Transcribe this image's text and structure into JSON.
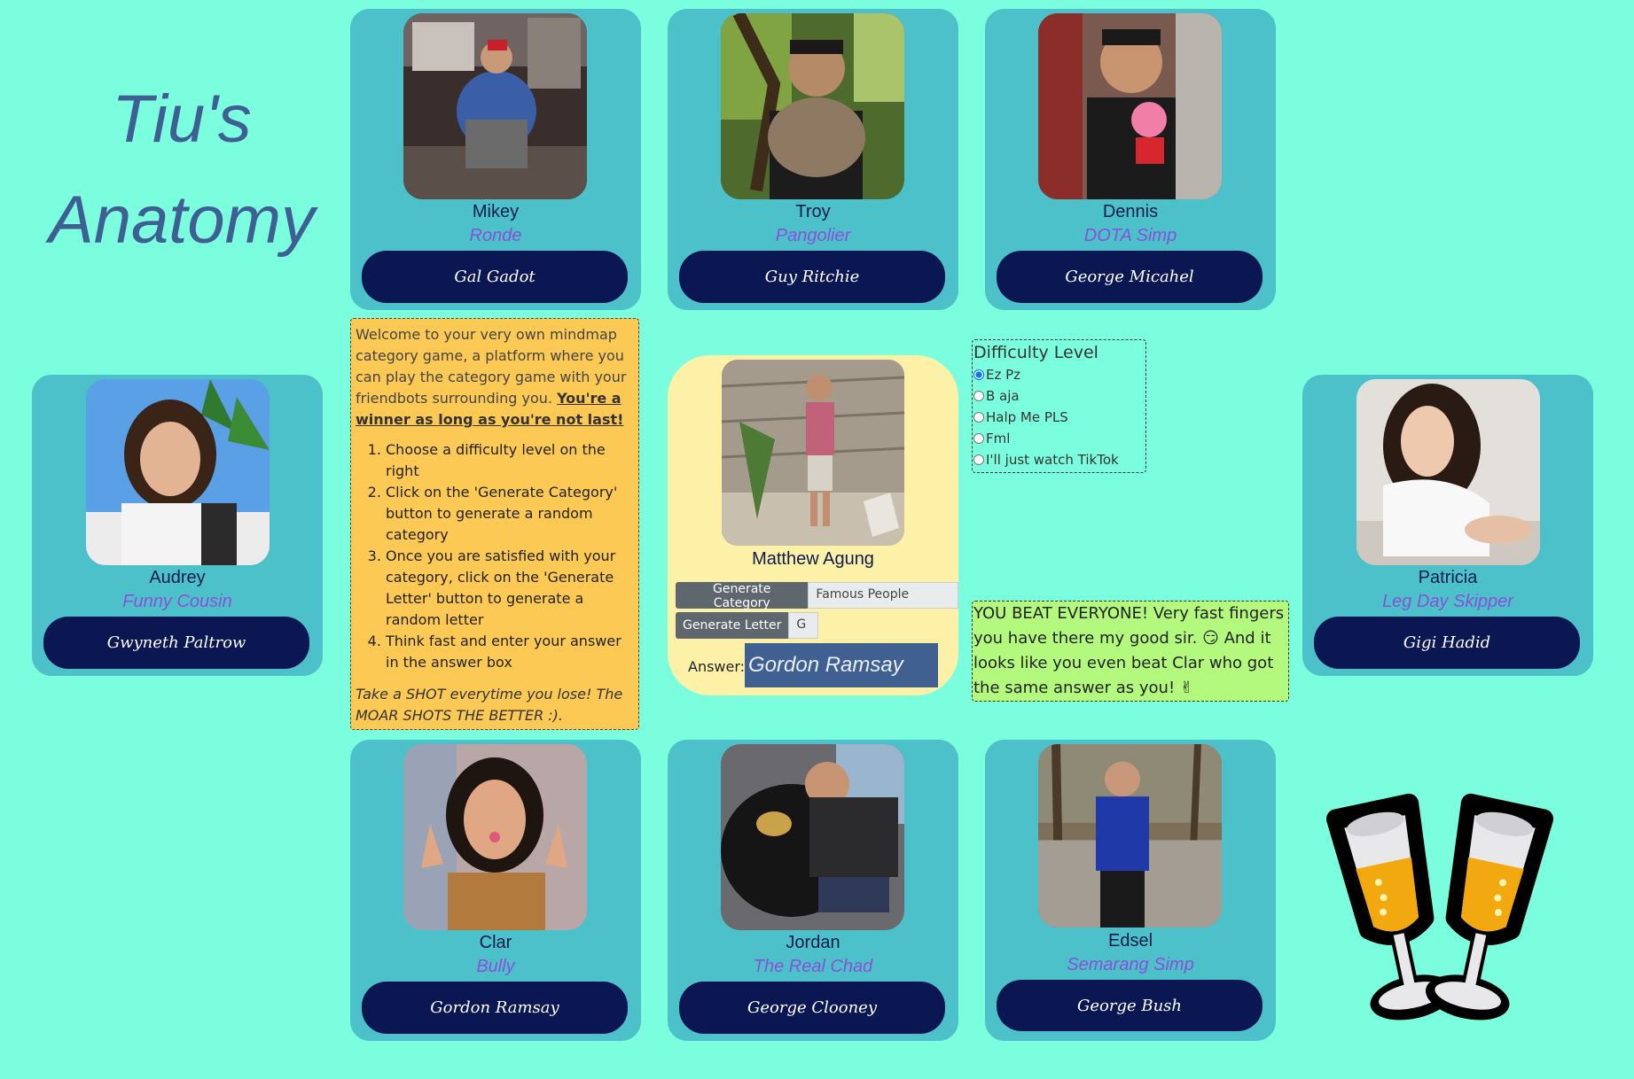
{
  "title": {
    "line1": "Tiu's",
    "line2": "Anatomy"
  },
  "players": [
    {
      "id": "mikey",
      "name": "Mikey",
      "role": "Ronde",
      "answer": "Gal Gadot"
    },
    {
      "id": "troy",
      "name": "Troy",
      "role": "Pangolier",
      "answer": "Guy Ritchie"
    },
    {
      "id": "dennis",
      "name": "Dennis",
      "role": "DOTA Simp",
      "answer": "George Micahel"
    },
    {
      "id": "audrey",
      "name": "Audrey",
      "role": "Funny Cousin",
      "answer": "Gwyneth Paltrow"
    },
    {
      "id": "patricia",
      "name": "Patricia",
      "role": "Leg Day Skipper",
      "answer": "Gigi Hadid"
    },
    {
      "id": "clar",
      "name": "Clar",
      "role": "Bully",
      "answer": "Gordon Ramsay"
    },
    {
      "id": "jordan",
      "name": "Jordan",
      "role": "The Real Chad",
      "answer": "George Clooney"
    },
    {
      "id": "edsel",
      "name": "Edsel",
      "role": "Semarang Simp",
      "answer": "George Bush"
    }
  ],
  "instructions": {
    "intro": "Welcome to your very own mindmap category game, a platform where you can play the category game with your friendbots surrounding you. ",
    "winner": "You're a winner as long as you're not last!",
    "steps": [
      "Choose a difficulty level on the right",
      "Click on the 'Generate Category' button to generate a random category",
      "Once you are satisfied with your category, click on the 'Generate Letter' button to generate a random letter",
      "Think fast and enter your answer in the answer box"
    ],
    "shot": "Take a SHOT everytime you lose! The MOAR SHOTS THE BETTER :)."
  },
  "user": {
    "name": "Matthew Agung",
    "generate_category_label": "Generate Category",
    "category": "Famous People",
    "generate_letter_label": "Generate Letter",
    "letter": "G",
    "answer_label": "Answer:",
    "answer": "Gordon Ramsay"
  },
  "difficulty": {
    "title": "Difficulty Level",
    "options": [
      "Ez Pz",
      "B aja",
      "Halp Me PLS",
      "Fml",
      "I'll just watch TikTok"
    ],
    "selected": "Ez Pz"
  },
  "result": {
    "text": "YOU BEAT EVERYONE! Very fast fingers you have there my good sir. 😏 And it looks like you even beat Clar who got the same answer as you! ✌"
  },
  "colors": {
    "background": "#7bfedd",
    "card": "#4cc1c9",
    "button": "#0b1753",
    "role_text": "#8b4fdb",
    "title": "#3f5e93",
    "instructions_bg": "#fcc954",
    "center_bg": "#fdf0a7",
    "result_bg": "#b3f97e",
    "answer_bg": "#406092"
  },
  "icons": {
    "celebration": "clinking-glasses-icon"
  }
}
